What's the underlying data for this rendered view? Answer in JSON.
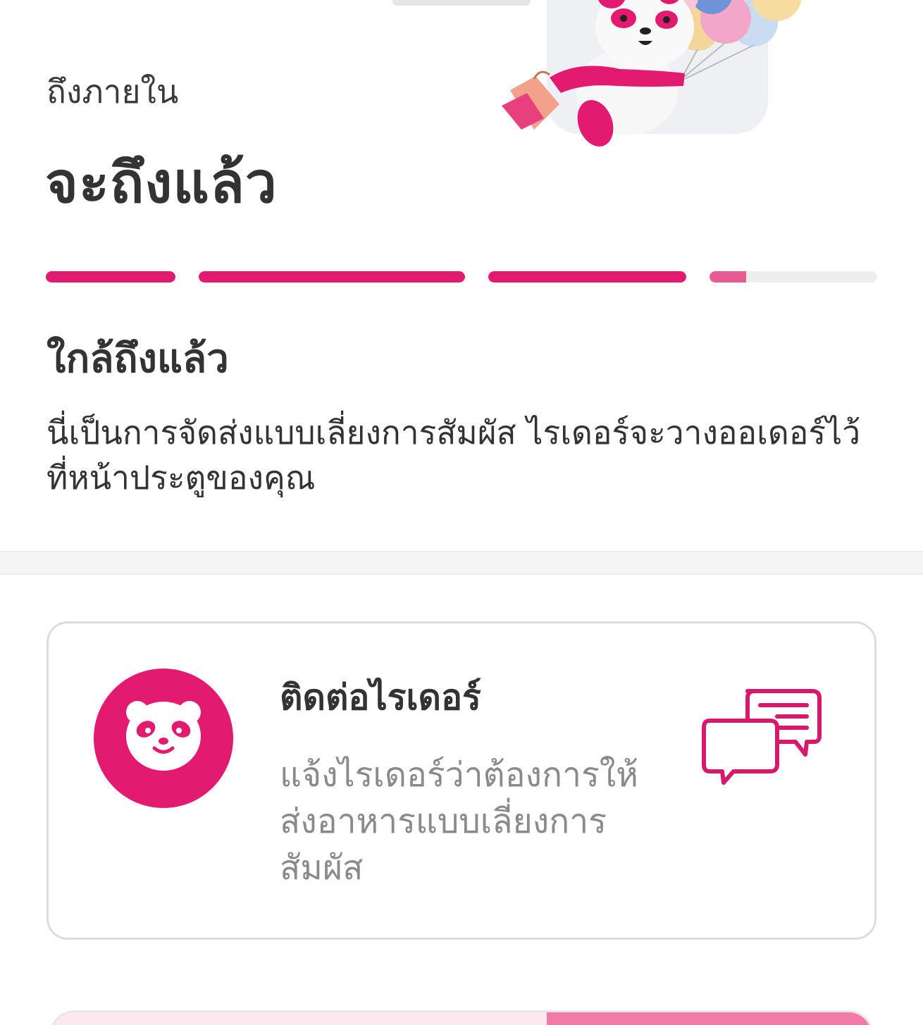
{
  "eta": {
    "label": "ถึงภายใน",
    "value": "จะถึงแล้ว"
  },
  "progress": {
    "steps": [
      1,
      1,
      1,
      0.22
    ],
    "color": "#e21b70"
  },
  "status": {
    "title": "ใกล้ถึงแล้ว",
    "description": "นี่เป็นการจัดส่งแบบเลี่ยงการสัมผัส ไรเดอร์จะวางออเดอร์ไว้ที่หน้าประตูของคุณ"
  },
  "contact_card": {
    "title": "ติดต่อไรเดอร์",
    "description": "แจ้งไรเดอร์ว่าต้องการให้ส่งอาหารแบบเลี่ยงการสัมผัส",
    "avatar_icon": "panda-logo-icon",
    "action_icon": "chat-bubbles-icon"
  },
  "colors": {
    "brand": "#e21b70",
    "text": "#333333",
    "muted": "#8a8a8a"
  }
}
